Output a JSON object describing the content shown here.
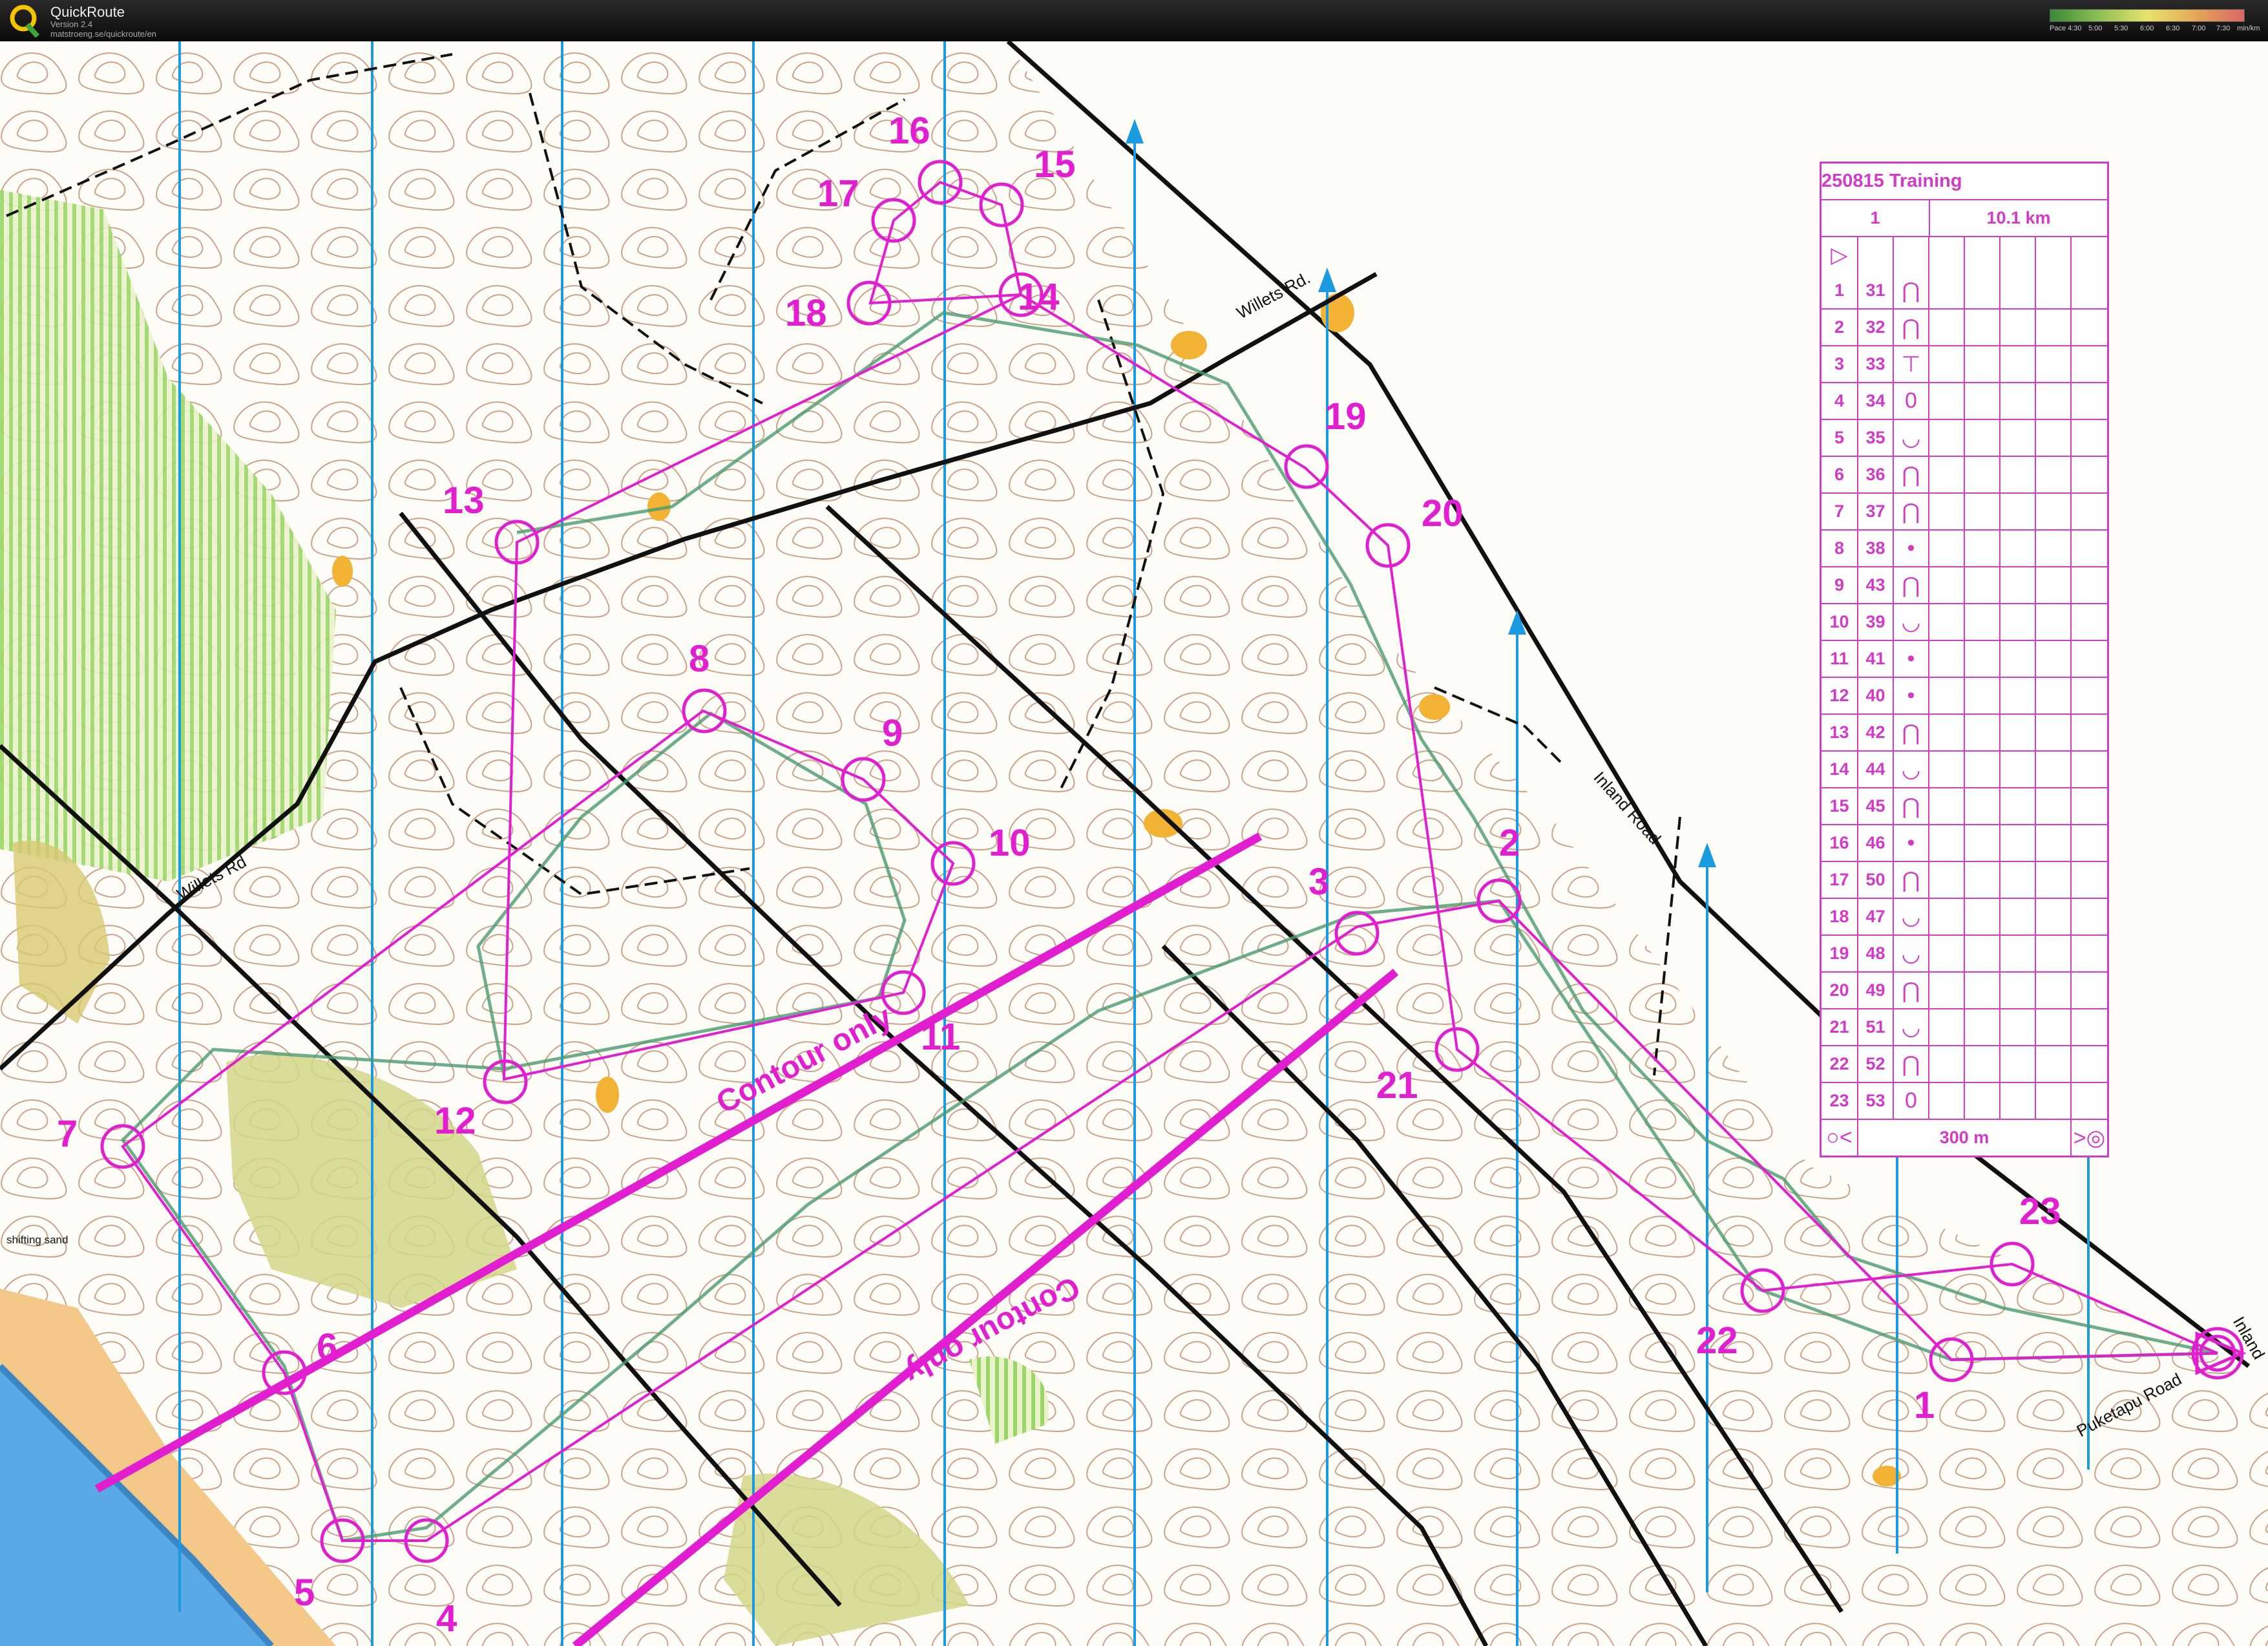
{
  "app": {
    "title": "QuickRoute",
    "version": "Version 2.4",
    "url": "matstroeng.se/quickroute/en",
    "logo_letter": "Q"
  },
  "pace_scale": {
    "labels": [
      "Pace 4:30",
      "5:00",
      "5:30",
      "6:00",
      "6:30",
      "7:00",
      "7:30",
      "min/km"
    ]
  },
  "colors": {
    "course": "#e21fd0",
    "contour": "#8a4a26",
    "north_line": "#1a9be0",
    "vegetation_green": "#9cd56a",
    "open_yellow": "#f2b234",
    "water": "#5aa8e6",
    "route": "#4a9a6e"
  },
  "map": {
    "road_labels": [
      "Willets Rd.",
      "Willets Rd",
      "Inland Road",
      "Puketapu Road",
      "Inland"
    ],
    "area_label": "shifting sand",
    "contour_only_labels": [
      "Contour only",
      "Contour only"
    ],
    "controls": [
      {
        "num": "1"
      },
      {
        "num": "2"
      },
      {
        "num": "3"
      },
      {
        "num": "4"
      },
      {
        "num": "5"
      },
      {
        "num": "6"
      },
      {
        "num": "7"
      },
      {
        "num": "8"
      },
      {
        "num": "9"
      },
      {
        "num": "10"
      },
      {
        "num": "11"
      },
      {
        "num": "12"
      },
      {
        "num": "13"
      },
      {
        "num": "14"
      },
      {
        "num": "15"
      },
      {
        "num": "16"
      },
      {
        "num": "17"
      },
      {
        "num": "18"
      },
      {
        "num": "19"
      },
      {
        "num": "20"
      },
      {
        "num": "21"
      },
      {
        "num": "22"
      },
      {
        "num": "23"
      }
    ]
  },
  "description_sheet": {
    "title": "250815 Training",
    "course": "1",
    "length": "10.1 km",
    "start_symbol": "▷",
    "rows": [
      {
        "n": "1",
        "code": "31",
        "feature": "⋂"
      },
      {
        "n": "2",
        "code": "32",
        "feature": "⋂"
      },
      {
        "n": "3",
        "code": "33",
        "feature": "⊤"
      },
      {
        "n": "4",
        "code": "34",
        "feature": "0"
      },
      {
        "n": "5",
        "code": "35",
        "feature": "◡"
      },
      {
        "n": "6",
        "code": "36",
        "feature": "⋂"
      },
      {
        "n": "7",
        "code": "37",
        "feature": "⋂"
      },
      {
        "n": "8",
        "code": "38",
        "feature": "•"
      },
      {
        "n": "9",
        "code": "43",
        "feature": "⋂"
      },
      {
        "n": "10",
        "code": "39",
        "feature": "◡"
      },
      {
        "n": "11",
        "code": "41",
        "feature": "•"
      },
      {
        "n": "12",
        "code": "40",
        "feature": "•"
      },
      {
        "n": "13",
        "code": "42",
        "feature": "⋂"
      },
      {
        "n": "14",
        "code": "44",
        "feature": "◡"
      },
      {
        "n": "15",
        "code": "45",
        "feature": "⋂"
      },
      {
        "n": "16",
        "code": "46",
        "feature": "•"
      },
      {
        "n": "17",
        "code": "50",
        "feature": "⋂"
      },
      {
        "n": "18",
        "code": "47",
        "feature": "◡"
      },
      {
        "n": "19",
        "code": "48",
        "feature": "◡"
      },
      {
        "n": "20",
        "code": "49",
        "feature": "⋂"
      },
      {
        "n": "21",
        "code": "51",
        "feature": "◡"
      },
      {
        "n": "22",
        "code": "52",
        "feature": "⋂"
      },
      {
        "n": "23",
        "code": "53",
        "feature": "0"
      }
    ],
    "finish_distance": "300 m",
    "finish_left_symbol": "○<",
    "finish_right_symbol": ">◎"
  }
}
